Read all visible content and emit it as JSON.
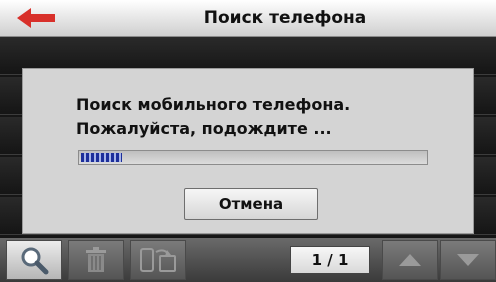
{
  "header": {
    "title": "Поиск телефона",
    "back_icon": "back-arrow-icon"
  },
  "dialog": {
    "message_line1": "Поиск мобильного телефона.",
    "message_line2": "Пожалуйста, подождите ...",
    "progress_fraction": 0.12,
    "cancel_label": "Отмена"
  },
  "toolbar": {
    "page_counter": "1 / 1",
    "icons": [
      "search-icon",
      "trash-icon",
      "phone-sync-icon",
      "arrow-up-icon",
      "arrow-down-icon"
    ]
  },
  "colors": {
    "accent_red": "#d8302a",
    "progress_blue": "#1d2f9a"
  }
}
